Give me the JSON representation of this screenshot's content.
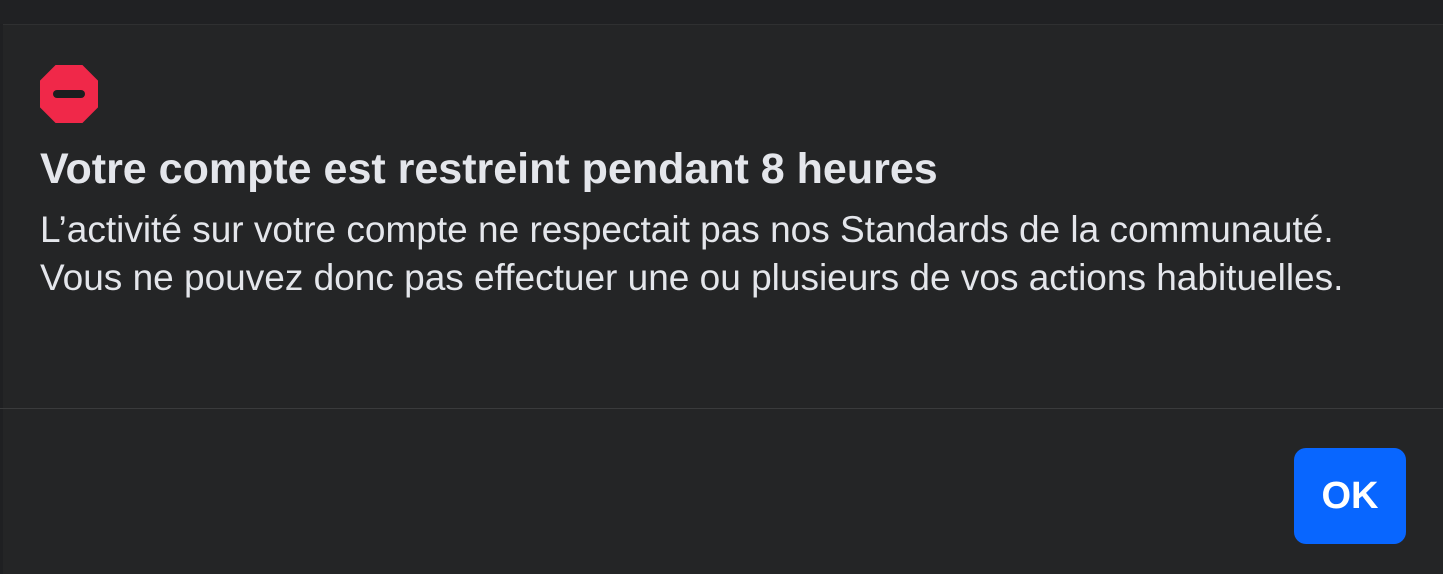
{
  "dialog": {
    "icon": "restricted-icon",
    "title": "Votre compte est restreint pendant 8 heures",
    "description": "L’activité sur votre compte ne respectait pas nos Standards de la communauté. Vous ne pouvez donc pas effectuer une ou plusieurs de vos actions habituelles.",
    "ok_label": "OK"
  },
  "colors": {
    "background": "#242526",
    "text": "#e4e6eb",
    "icon_red": "#f02849",
    "button_blue": "#0866ff"
  }
}
